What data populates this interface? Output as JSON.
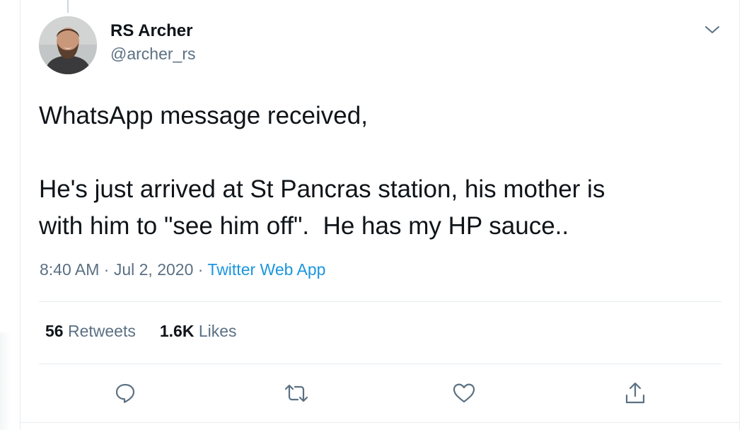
{
  "author": {
    "display_name": "RS Archer",
    "handle": "@archer_rs"
  },
  "tweet": {
    "text": "WhatsApp message received,\n\nHe's just arrived at St Pancras station, his mother is\nwith him to \"see him off\".  He has my HP sauce..",
    "time": "8:40 AM",
    "date": "Jul 2, 2020",
    "separator": "·",
    "source": "Twitter Web App"
  },
  "stats": {
    "retweets_count": "56",
    "retweets_label": "Retweets",
    "likes_count": "1.6K",
    "likes_label": "Likes"
  },
  "icons": {
    "menu": "chevron-down-icon",
    "reply": "reply-icon",
    "retweet": "retweet-icon",
    "like": "heart-icon",
    "share": "share-icon"
  },
  "colors": {
    "link": "#1b95e0",
    "secondary_text": "#5b7083",
    "primary_text": "#0f1419",
    "border": "#e6ecf0"
  }
}
